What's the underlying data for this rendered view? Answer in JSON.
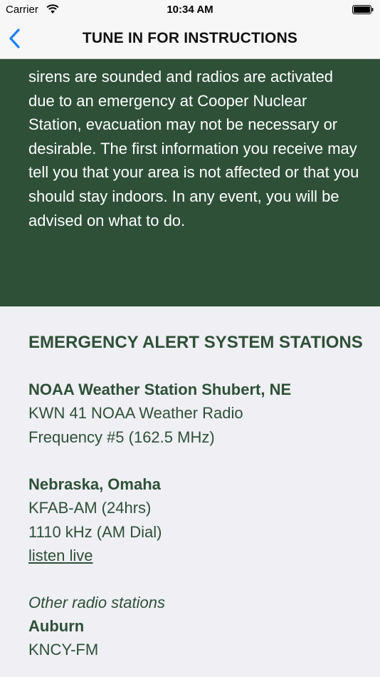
{
  "status_bar": {
    "carrier": "Carrier",
    "time": "10:34 AM"
  },
  "nav": {
    "title": "TUNE IN FOR INSTRUCTIONS",
    "back_icon": "chevron-left-icon",
    "accent": "#1a7ff5"
  },
  "intro": {
    "text": "sirens are sounded and radios are activated due to an emergency at Cooper Nuclear Station, evacuation may not be necessary or desirable. The first information you receive may tell you that your area is not affected or that you should stay indoors. In any event, you will be advised on what to do.",
    "background": "#2e5037"
  },
  "section": {
    "heading": "EMERGENCY ALERT SYSTEM STATIONS",
    "stations": [
      {
        "name": "NOAA Weather Station Shubert, NE",
        "lines": [
          "KWN 41 NOAA Weather Radio",
          "Frequency #5 (162.5 MHz)"
        ]
      },
      {
        "name": "Nebraska, Omaha",
        "lines": [
          "KFAB-AM (24hrs)",
          "1110 kHz (AM Dial)"
        ],
        "link": "listen live"
      }
    ],
    "other_label": "Other radio stations",
    "other_station": {
      "name": "Auburn",
      "line": "KNCY-FM"
    }
  }
}
